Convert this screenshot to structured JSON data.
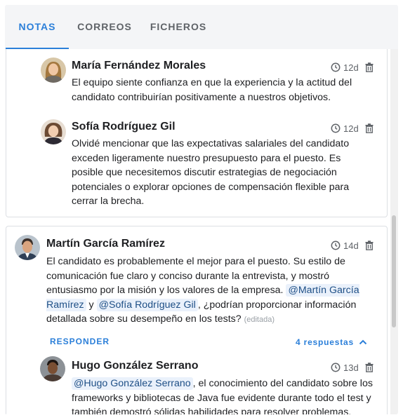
{
  "tabs": [
    {
      "label": "NOTAS",
      "active": true
    },
    {
      "label": "CORREOS",
      "active": false
    },
    {
      "label": "FICHEROS",
      "active": false
    }
  ],
  "notes": [
    {
      "author": "María Fernández Morales",
      "age": "12d",
      "text": "El equipo siente confianza en que la experiencia y la actitud del candidato contribuirían positivamente a nuestros objetivos."
    },
    {
      "author": "Sofía Rodríguez Gil",
      "age": "12d",
      "text": "Olvidé mencionar que las expectativas salariales del candidato exceden ligeramente nuestro presupuesto para el puesto. Es posible que necesitemos discutir estrategias de negociación potenciales o explorar opciones de compensación flexible para cerrar la brecha."
    },
    {
      "author": "Martín García Ramírez",
      "age": "14d",
      "text_before": "El candidato es probablemente el mejor para el puesto. Su estilo de comunicación fue claro y conciso durante la entrevista, y mostró entusiasmo por la misión y los valores de la empresa. ",
      "mention1": "@Martín García Ramírez",
      "text_between": " y ",
      "mention2": "@Sofía Rodríguez Gil",
      "text_after": ", ¿podrían proporcionar información detallada sobre su desempeño en los tests?",
      "edited": "(editada)",
      "reply_label": "RESPONDER",
      "replies_label": "4 respuestas"
    },
    {
      "author": "Hugo González Serrano",
      "age": "13d",
      "mention": "@Hugo González Serrano",
      "text_after": ", el conocimiento del candidato sobre los frameworks y bibliotecas de Java fue evidente durante todo el test y también demostró sólidas habilidades para resolver problemas."
    }
  ],
  "colors": {
    "accent": "#2b7fd9",
    "mention_bg": "#eaf1fb"
  },
  "icons": {
    "time": "clock-icon",
    "delete": "trash-icon",
    "collapse": "chevron-up-icon"
  }
}
